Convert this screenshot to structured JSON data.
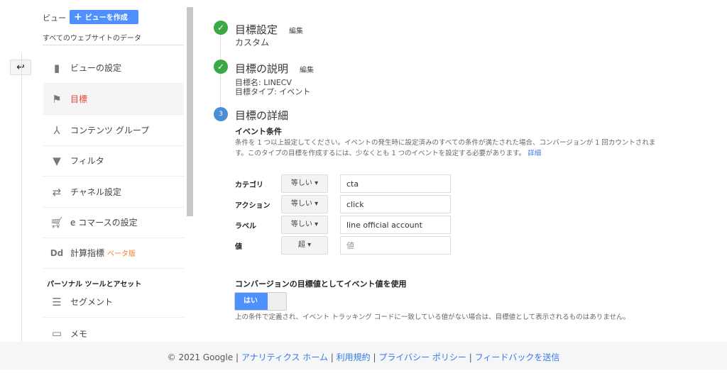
{
  "sidebar": {
    "view_label": "ビュー",
    "create_view": "ビューを作成",
    "account": "すべてのウェブサイトのデータ",
    "items": [
      {
        "label": "ビューの設定",
        "icon": "document-icon"
      },
      {
        "label": "目標",
        "icon": "flag-icon",
        "active": true
      },
      {
        "label": "コンテンツ グループ",
        "icon": "content-grouping-icon"
      },
      {
        "label": "フィルタ",
        "icon": "filter-icon"
      },
      {
        "label": "チャネル設定",
        "icon": "channel-settings-icon"
      },
      {
        "label": "e コマースの設定",
        "icon": "cart-icon"
      },
      {
        "label": "計算指標",
        "icon": "dd-icon",
        "badge": "ベータ版"
      }
    ],
    "section": "パーソナル ツールとアセット",
    "personal": [
      {
        "label": "セグメント",
        "icon": "segment-icon"
      },
      {
        "label": "メモ",
        "icon": "memo-icon"
      }
    ]
  },
  "steps": [
    {
      "number": "1",
      "title": "目標設定",
      "edit": "編集",
      "summary": [
        "カスタム"
      ],
      "status": "done"
    },
    {
      "number": "2",
      "title": "目標の説明",
      "edit": "編集",
      "summary": [
        "目標名: LINECV",
        "目標タイプ: イベント"
      ],
      "status": "done"
    },
    {
      "number": "3",
      "title": "目標の詳細",
      "status": "current"
    }
  ],
  "details": {
    "heading": "イベント条件",
    "description": "条件を 1 つ以上設定してください。イベントの発生時に設定済みのすべての条件が満たされた場合、コンバージョンが 1 回カウントされます。このタイプの目標を作成するには、少なくとも 1 つのイベントを設定する必要があります。",
    "more_link": "詳細",
    "conditions": [
      {
        "label": "カテゴリ",
        "operator": "等しい",
        "value": "cta",
        "placeholder": ""
      },
      {
        "label": "アクション",
        "operator": "等しい",
        "value": "click",
        "placeholder": ""
      },
      {
        "label": "ラベル",
        "operator": "等しい",
        "value": "line official account",
        "placeholder": ""
      },
      {
        "label": "値",
        "operator": "超",
        "value": "",
        "placeholder": "値"
      }
    ],
    "use_value_heading": "コンバージョンの目標値としてイベント値を使用",
    "toggle_label": "はい",
    "toggle_on": true,
    "note": "上の条件で定義され、イベント トラッキング コードに一致している値がない場合は、目標値として表示されるものはありません。"
  },
  "footer": {
    "copyright": "© 2021 Google",
    "links": [
      "アナリティクス ホーム",
      "利用規約",
      "プライバシー ポリシー",
      "フィードバックを送信"
    ]
  },
  "colors": {
    "accent": "#4d90fe",
    "active": "#dd4b39",
    "done": "#3aa845",
    "link": "#3b78e7"
  }
}
